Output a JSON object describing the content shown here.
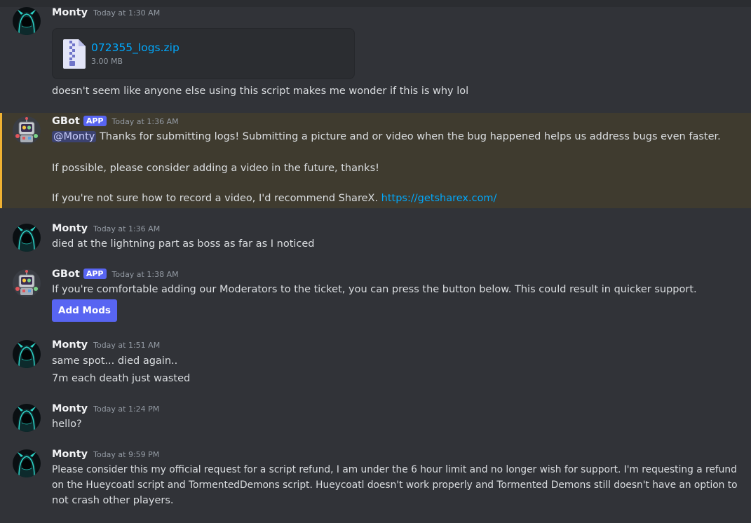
{
  "colors": {
    "background": "#313338",
    "highlight_background": "#3f3b2f",
    "highlight_border": "#f0b232",
    "link": "#00a8fc",
    "mention_background": "#3c4270",
    "app_badge": "#5865f2",
    "button": "#5865f2"
  },
  "messages": [
    {
      "author": "Monty",
      "timestamp": "Today at 1:30 AM",
      "avatar_icon": "hooded-figure-avatar-icon",
      "attachment": {
        "icon": "zip-file-icon",
        "file_name": "072355_logs.zip",
        "file_size": "3.00 MB"
      },
      "lines": [
        "doesn't seem like anyone else using this script makes me wonder if this is why lol"
      ]
    },
    {
      "author": "GBot",
      "badge": "APP",
      "timestamp": "Today at 1:36 AM",
      "avatar_icon": "robot-avatar-icon",
      "mention": "@Monty",
      "lines": [
        "Thanks for submitting logs! Submitting a picture and or video when the bug happened helps us address bugs even faster.",
        "If possible, please consider adding a video in the future, thanks!",
        "If you're not sure how to record a video, I'd recommend ShareX."
      ],
      "link": "https://getsharex.com/"
    },
    {
      "author": "Monty",
      "timestamp": "Today at 1:36 AM",
      "avatar_icon": "hooded-figure-avatar-icon",
      "lines": [
        "died at the lightning part as boss as far as I noticed"
      ]
    },
    {
      "author": "GBot",
      "badge": "APP",
      "timestamp": "Today at 1:38 AM",
      "avatar_icon": "robot-avatar-icon",
      "lines": [
        "If you're comfortable adding our Moderators to the ticket, you can press the button below. This could result in quicker support."
      ],
      "button_label": "Add Mods"
    },
    {
      "author": "Monty",
      "timestamp": "Today at 1:51 AM",
      "avatar_icon": "hooded-figure-avatar-icon",
      "lines": [
        "same spot... died again..",
        "7m each death just wasted"
      ]
    },
    {
      "author": "Monty",
      "timestamp": "Today at 1:24 PM",
      "avatar_icon": "hooded-figure-avatar-icon",
      "lines": [
        "hello?"
      ]
    },
    {
      "author": "Monty",
      "timestamp": "Today at 9:59 PM",
      "avatar_icon": "hooded-figure-avatar-icon",
      "lines": [
        "Please consider this my official request for a script refund, I am under the 6 hour limit and no longer wish for support. I'm requesting a refund",
        "on the Hueycoatl script and TormentedDemons script. Hueycoatl doesn't work properly and Tormented Demons still doesn't have an option to",
        "not crash other players."
      ]
    }
  ]
}
